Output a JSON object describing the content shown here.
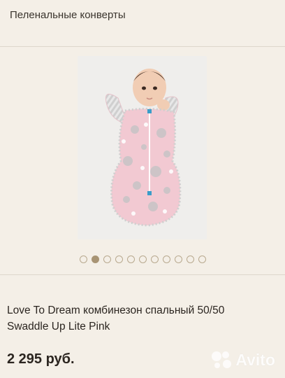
{
  "header": {
    "title": "Пеленальные конверты"
  },
  "gallery": {
    "image_icon": "baby-swaddle-photo",
    "dots_total": 11,
    "active_index": 1
  },
  "product": {
    "title_line1": "Love To Dream комбинезон спальный 50/50",
    "title_line2": "Swaddle Up Lite Pink",
    "price": "2 295 руб."
  },
  "watermark": {
    "logo": "avito-logo-icon",
    "text": "Avito"
  },
  "colors": {
    "background": "#f4efe7",
    "dot_active": "#a89474",
    "dot_border": "#b8a98f",
    "suit_pink": "#f2c9d2"
  }
}
